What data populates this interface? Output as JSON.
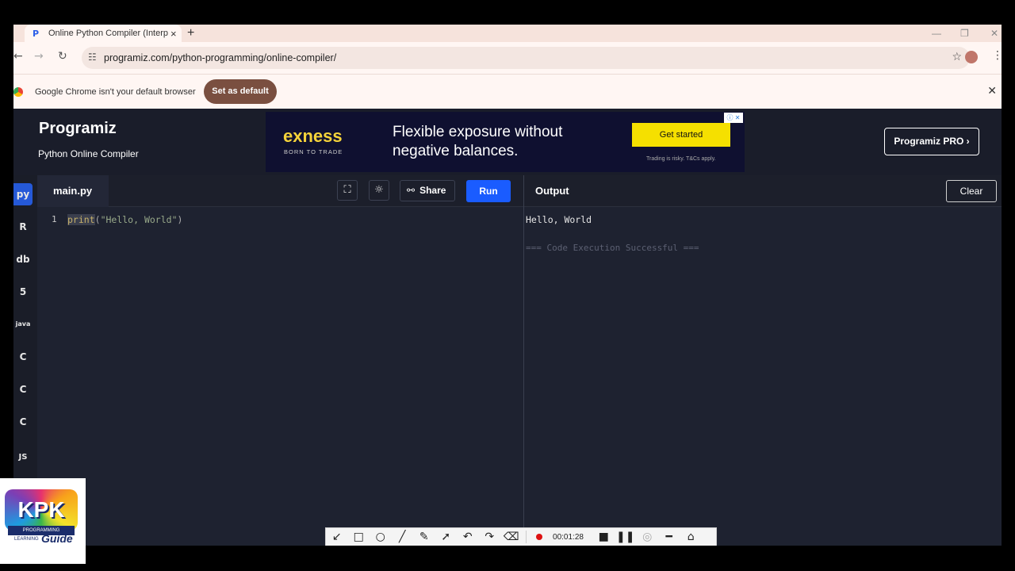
{
  "browser": {
    "tab_title": "Online Python Compiler (Interp",
    "tab_favicon": "P",
    "new_tab": "+",
    "url": "programiz.com/python-programming/online-compiler/",
    "infobar_message": "Google Chrome isn't your default browser",
    "set_default_label": "Set as default"
  },
  "site": {
    "brand": "Programiz",
    "subtitle": "Python Online Compiler",
    "pro_button": "Programiz PRO ›",
    "ad": {
      "logo": "exness",
      "tagline": "BORN TO TRADE",
      "headline": "Flexible exposure without negative balances.",
      "cta": "Get started",
      "fine_print": "Trading is risky. T&Cs apply."
    }
  },
  "languages": [
    "py",
    "R",
    "db",
    "5",
    "java",
    "C",
    "C",
    "C",
    "JS"
  ],
  "editor": {
    "file_tab": "main.py",
    "share_label": "Share",
    "run_label": "Run",
    "line_number": "1",
    "code_keyword": "print",
    "code_open": "(",
    "code_string": "\"Hello, World\"",
    "code_close": ")"
  },
  "output": {
    "title": "Output",
    "clear_label": "Clear",
    "text": "Hello, World",
    "status": "=== Code Execution Successful ==="
  },
  "recorder": {
    "time": "00:01:28"
  },
  "channel_logo": {
    "name": "KPK",
    "ribbon": "PROGRAMMING",
    "sub": "LEARNING",
    "guide": "Guide"
  },
  "colors": {
    "run_button": "#1a5cff",
    "active_language": "#2559d8",
    "set_default": "#7a4f40",
    "ad_cta": "#f5e000"
  }
}
